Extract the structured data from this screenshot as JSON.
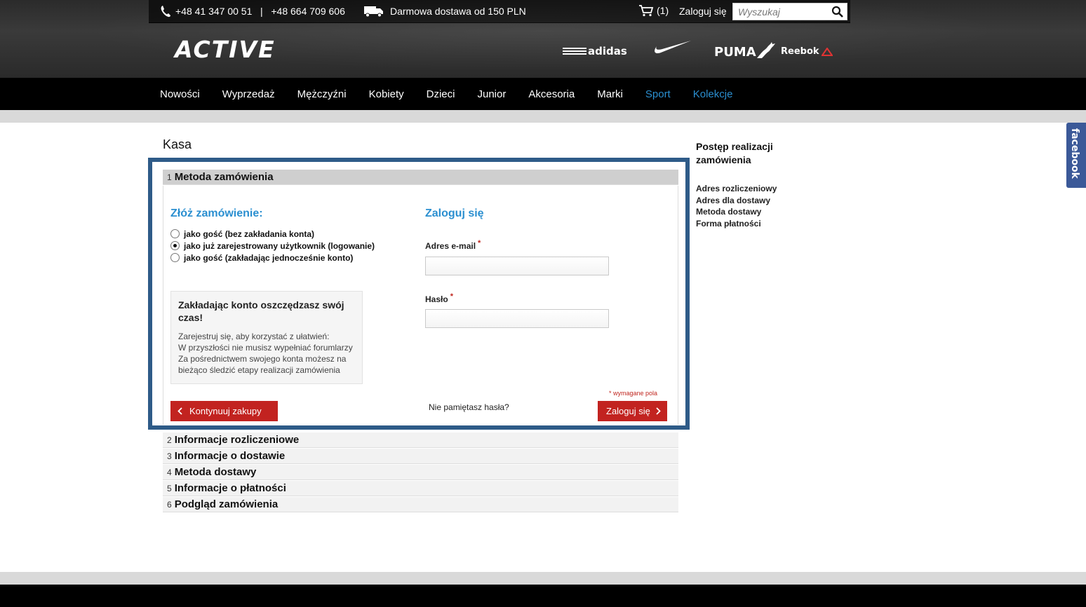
{
  "topbar": {
    "phones": "+48 41 347 00 51   |   +48 664 709 606",
    "delivery": "Darmowa dostawa od 150 PLN",
    "cart_count": "(1)",
    "login": "Zaloguj się",
    "search_placeholder": "Wyszukaj"
  },
  "logo": "ACTIVE",
  "brands": {
    "adidas": "adidas",
    "puma": "PUMA",
    "reebok": "Reebok"
  },
  "nav": [
    "Nowości",
    "Wyprzedaż",
    "Mężczyźni",
    "Kobiety",
    "Dzieci",
    "Junior",
    "Akcesoria",
    "Marki",
    "Sport",
    "Kolekcje"
  ],
  "colors": {
    "accent_blue": "#2b8fd0",
    "button_red": "#c22320",
    "highlight_border": "#2e5b88",
    "facebook": "#3b5998"
  },
  "page_title": "Kasa",
  "steps": [
    {
      "num": "1",
      "label": "Metoda zamówienia"
    },
    {
      "num": "2",
      "label": "Informacje rozliczeniowe"
    },
    {
      "num": "3",
      "label": "Informacje o dostawie"
    },
    {
      "num": "4",
      "label": "Metoda dostawy"
    },
    {
      "num": "5",
      "label": "Informacje o płatności"
    },
    {
      "num": "6",
      "label": "Podgląd zamówienia"
    }
  ],
  "order": {
    "title": "Złóż zamówienie:",
    "options": [
      {
        "label": "jako gość (bez zakładania konta)",
        "checked": false
      },
      {
        "label": "jako już zarejestrowany użytkownik (logowanie)",
        "checked": true
      },
      {
        "label": "jako gość (zakładając jednocześnie konto)",
        "checked": false
      }
    ],
    "infobox_title": "Zakładając konto oszczędzasz swój czas!",
    "infobox_lines": [
      "Zarejestruj się, aby korzystać z ułatwień:",
      "W przyszłości nie musisz wypełniać forumlarzy",
      "Za pośrednictwem swojego konta możesz na",
      "bieżąco śledzić etapy realizacji zamówienia"
    ]
  },
  "login": {
    "title": "Zaloguj się",
    "email_label": "Adres e-mail",
    "password_label": "Hasło",
    "required_mark": "*",
    "email_value": "",
    "password_value": "",
    "required_note": "* wymagane pola",
    "forgot": "Nie pamiętasz hasła?",
    "submit": "Zaloguj się"
  },
  "continue_button": "Kontynuuj zakupy",
  "sidebar": {
    "title": "Postęp realizacji zamówienia",
    "items": [
      "Adres rozliczeniowy",
      "Adres dla dostawy",
      "Metoda dostawy",
      "Forma płatności"
    ]
  },
  "facebook_tab": "facebook"
}
